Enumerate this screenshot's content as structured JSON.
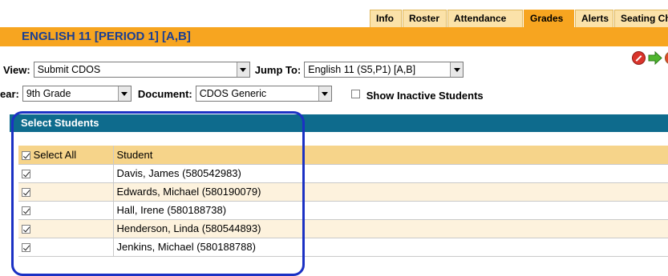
{
  "tabs": [
    "Info",
    "Roster",
    "Attendance",
    "Grades",
    "Alerts",
    "Seating Chart"
  ],
  "active_tab": "Grades",
  "title": "ENGLISH 11 [PERIOD 1] [A,B]",
  "view": {
    "label": "View:",
    "value": "Submit CDOS"
  },
  "jump_to": {
    "label": "Jump To:",
    "value": "English 11 (S5,P1) [A,B]"
  },
  "year": {
    "label": "ear:",
    "value": "9th Grade"
  },
  "document": {
    "label": "Document:",
    "value": "CDOS Generic"
  },
  "show_inactive": {
    "label": "Show Inactive Students",
    "checked": false
  },
  "icons": [
    "cancel-icon",
    "go-arrow-icon",
    "help-icon"
  ],
  "section_title": "Select Students",
  "table": {
    "select_all_label": "Select All",
    "student_header": "Student",
    "rows": [
      {
        "name": "Davis, James (580542983)",
        "checked": true
      },
      {
        "name": "Edwards, Michael (580190079)",
        "checked": true
      },
      {
        "name": "Hall, Irene (580188738)",
        "checked": true
      },
      {
        "name": "Henderson, Linda (580544893)",
        "checked": true
      },
      {
        "name": "Jenkins, Michael (580188788)",
        "checked": true
      }
    ]
  },
  "colors": {
    "accent": "#f7a520",
    "title_text": "#1a3f93",
    "section_bar": "#0e6b8d",
    "highlight": "#1b31c4"
  }
}
